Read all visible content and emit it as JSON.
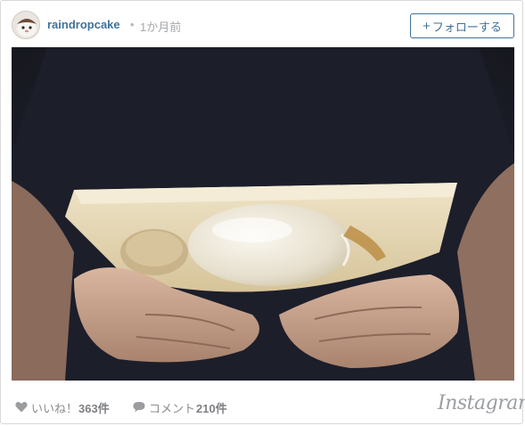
{
  "post": {
    "username": "raindropcake",
    "separator": "•",
    "time_ago": "1か月前",
    "follow_label": "フォローする",
    "follow_plus": "+"
  },
  "footer": {
    "likes_label": "いいね！",
    "likes_count": "363件",
    "comments_label": "コメント",
    "comments_count": "210件",
    "brand": "Instagram"
  },
  "icons": {
    "like": "heart-icon",
    "comment": "speech-bubble-icon"
  },
  "colors": {
    "accent": "#3f729b",
    "muted": "#8a8c90",
    "border": "#d9d9d9"
  }
}
